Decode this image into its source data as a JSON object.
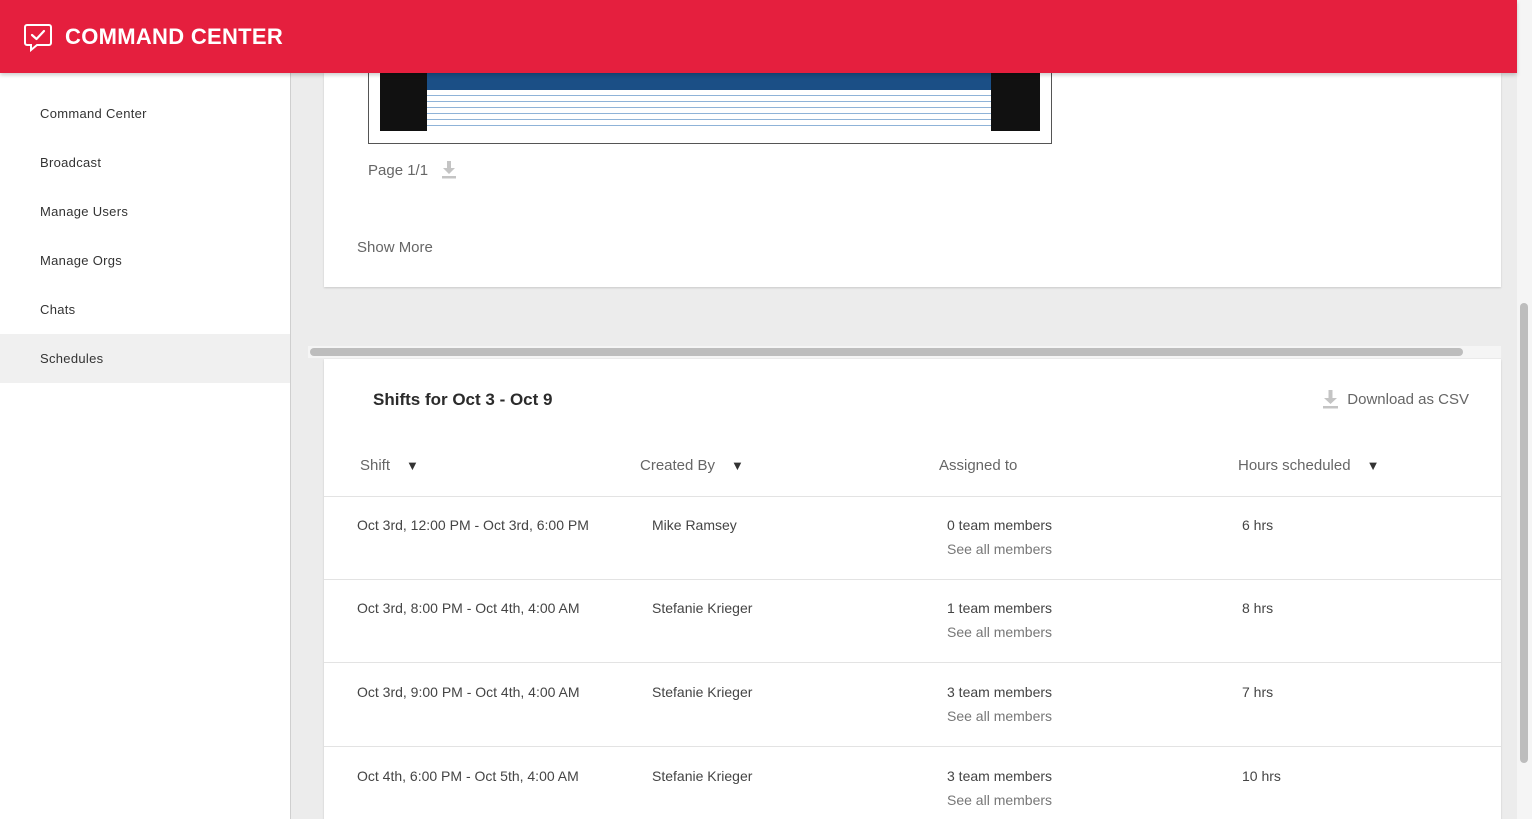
{
  "app": {
    "title": "COMMAND CENTER"
  },
  "colors": {
    "brand": "#e51f3e",
    "active_nav": "#f0f0f0"
  },
  "sidebar": {
    "items": [
      {
        "label": "Command Center",
        "active": false
      },
      {
        "label": "Broadcast",
        "active": false
      },
      {
        "label": "Manage Users",
        "active": false
      },
      {
        "label": "Manage Orgs",
        "active": false
      },
      {
        "label": "Chats",
        "active": false
      },
      {
        "label": "Schedules",
        "active": true
      }
    ]
  },
  "preview": {
    "page_label": "Page 1/1",
    "show_more_label": "Show More"
  },
  "shifts": {
    "title": "Shifts for Oct 3 - Oct 9",
    "download_label": "Download as CSV",
    "columns": {
      "shift": "Shift",
      "created_by": "Created By",
      "assigned_to": "Assigned to",
      "hours": "Hours scheduled"
    },
    "rows": [
      {
        "shift": "Oct 3rd, 12:00 PM - Oct 3rd, 6:00 PM",
        "created_by": "Mike Ramsey",
        "assigned": "0 team members",
        "see_all": "See all members",
        "hours": "6 hrs"
      },
      {
        "shift": "Oct 3rd, 8:00 PM - Oct 4th, 4:00 AM",
        "created_by": "Stefanie Krieger",
        "assigned": "1 team members",
        "see_all": "See all members",
        "hours": "8 hrs"
      },
      {
        "shift": "Oct 3rd, 9:00 PM - Oct 4th, 4:00 AM",
        "created_by": "Stefanie Krieger",
        "assigned": "3 team members",
        "see_all": "See all members",
        "hours": "7 hrs"
      },
      {
        "shift": "Oct 4th, 6:00 PM - Oct 5th, 4:00 AM",
        "created_by": "Stefanie Krieger",
        "assigned": "3 team members",
        "see_all": "See all members",
        "hours": "10 hrs"
      }
    ]
  },
  "icons": {
    "logo": "chat-check-icon",
    "download": "download-icon",
    "sort": "sort-down-icon"
  }
}
